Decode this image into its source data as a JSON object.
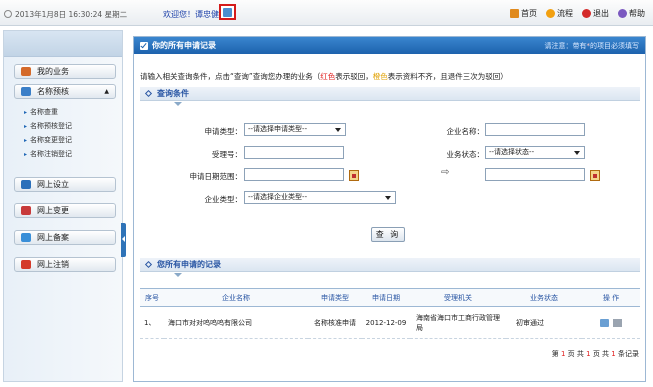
{
  "topbar": {
    "datetime": "2013年1月8日 16:30:24 星期二",
    "welcome": "欢迎您！谭忠健",
    "links": [
      {
        "label": "首页",
        "icon": "home-icon"
      },
      {
        "label": "流程",
        "icon": "flow-icon"
      },
      {
        "label": "退出",
        "icon": "exit-icon"
      },
      {
        "label": "帮助",
        "icon": "help-icon"
      }
    ]
  },
  "sidebar": {
    "items": [
      {
        "label": "我的业务",
        "icon": "business-icon",
        "color": "#d46a2a"
      },
      {
        "label": "名称预核",
        "icon": "name-check-icon",
        "color": "#3a7fc8"
      },
      {
        "label": "网上设立",
        "icon": "establish-icon",
        "color": "#2a6fba"
      },
      {
        "label": "网上变更",
        "icon": "change-icon",
        "color": "#c83a3a"
      },
      {
        "label": "网上备案",
        "icon": "record-icon",
        "color": "#3a8fd8"
      },
      {
        "label": "网上注销",
        "icon": "cancel-icon",
        "color": "#d43a2a"
      }
    ],
    "subitems": [
      "名称查重",
      "名称预核登记",
      "名称变更登记",
      "名称注销登记"
    ]
  },
  "main": {
    "title": "你的所有申请记录",
    "note_prefix": "请注意：带有",
    "note_star": "*",
    "note_suffix": "的项目必须填写",
    "intro_a": "请输入相关查询条件，点击“查询”查询您办理的业务（",
    "intro_red": "红色",
    "intro_b": "表示驳回，",
    "intro_gold": "橙色",
    "intro_c": "表示资料不齐，且退件三次为驳回）",
    "query_section": "查询条件",
    "records_section": "您所有申请的记录",
    "form": {
      "apply_type_label": "申请类型：",
      "apply_type_value": "--请选择申请类型--",
      "company_name_label": "企业名称：",
      "company_name_value": "",
      "accept_no_label": "受理号：",
      "accept_no_value": "",
      "status_label": "业务状态：",
      "status_value": "--请选择状态--",
      "date_range_label": "申请日期范围：",
      "date_from": "",
      "date_to": "",
      "range_arrow": "⇨",
      "company_type_label": "企业类型：",
      "company_type_value": "--请选择企业类型--",
      "query_button": "查 询"
    },
    "table": {
      "headers": [
        "序号",
        "企业名称",
        "申请类型",
        "申请日期",
        "受理机关",
        "业务状态",
        "操 作"
      ],
      "rows": [
        {
          "no": "1、",
          "company": "海口市对对呜呜呜有限公司",
          "type": "名称核准申请",
          "date": "2012-12-09",
          "agency": "海南省海口市工商行政管理局",
          "status": "初审通过"
        }
      ]
    },
    "pager": {
      "p1": "第",
      "current": "1",
      "p2": "页 共",
      "total_pages": "1",
      "p3": "页 共",
      "total_records": "1",
      "p4": "条记录"
    }
  }
}
